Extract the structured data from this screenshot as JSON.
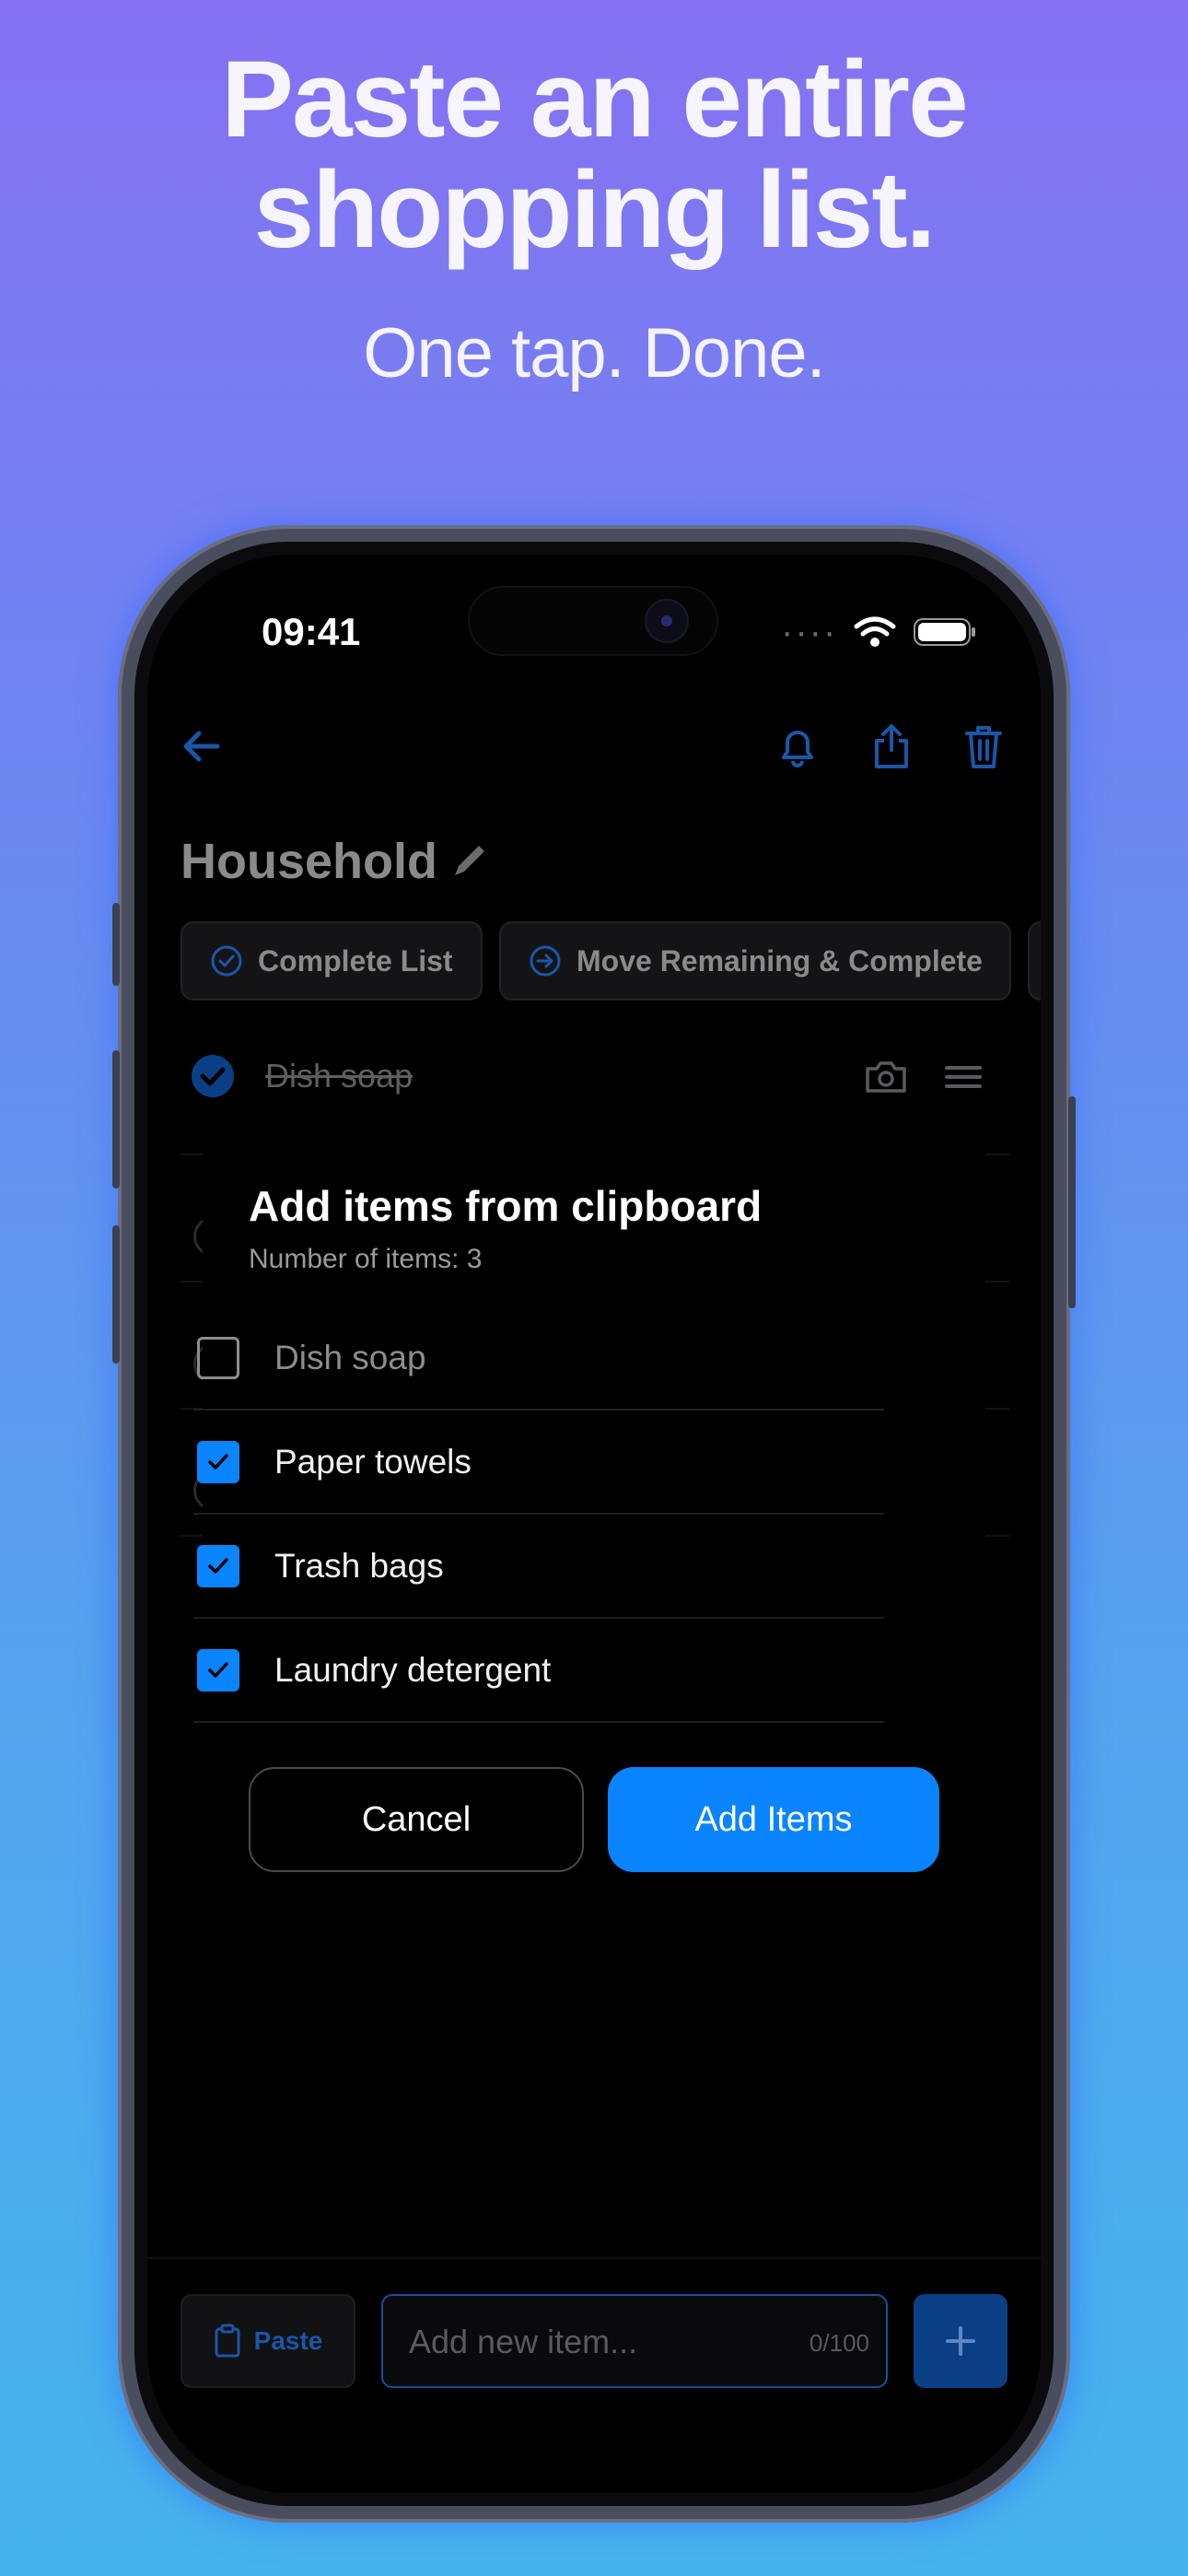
{
  "marketing": {
    "headline_line1": "Paste an entire",
    "headline_line2": "shopping list.",
    "subheadline": "One tap. Done."
  },
  "status_bar": {
    "time": "09:41"
  },
  "toolbar": {
    "back_icon": "arrow-left-icon",
    "actions": [
      "bell-icon",
      "share-icon",
      "trash-icon"
    ]
  },
  "list": {
    "title": "Household",
    "edit_icon": "pencil-icon",
    "chips": [
      {
        "label": "Complete List",
        "icon": "check-circle-icon"
      },
      {
        "label": "Move Remaining & Complete",
        "icon": "arrow-circle-icon"
      }
    ],
    "completed_item": {
      "label": "Dish soap",
      "checked": true
    }
  },
  "dialog": {
    "title": "Add items from clipboard",
    "count_text": "Number of items: 3",
    "items": [
      {
        "label": "Dish soap",
        "checked": false
      },
      {
        "label": "Paper towels",
        "checked": true
      },
      {
        "label": "Trash bags",
        "checked": true
      },
      {
        "label": "Laundry detergent",
        "checked": true
      }
    ],
    "cancel_label": "Cancel",
    "confirm_label": "Add Items"
  },
  "bottom_bar": {
    "paste_label": "Paste",
    "input_placeholder": "Add new item...",
    "counter": "0/100",
    "add_icon": "plus-icon"
  },
  "colors": {
    "accent": "#0a84ff",
    "accent_dim": "#1b56a8",
    "background_top": "#8571f2",
    "background_bottom": "#45b4ec"
  }
}
